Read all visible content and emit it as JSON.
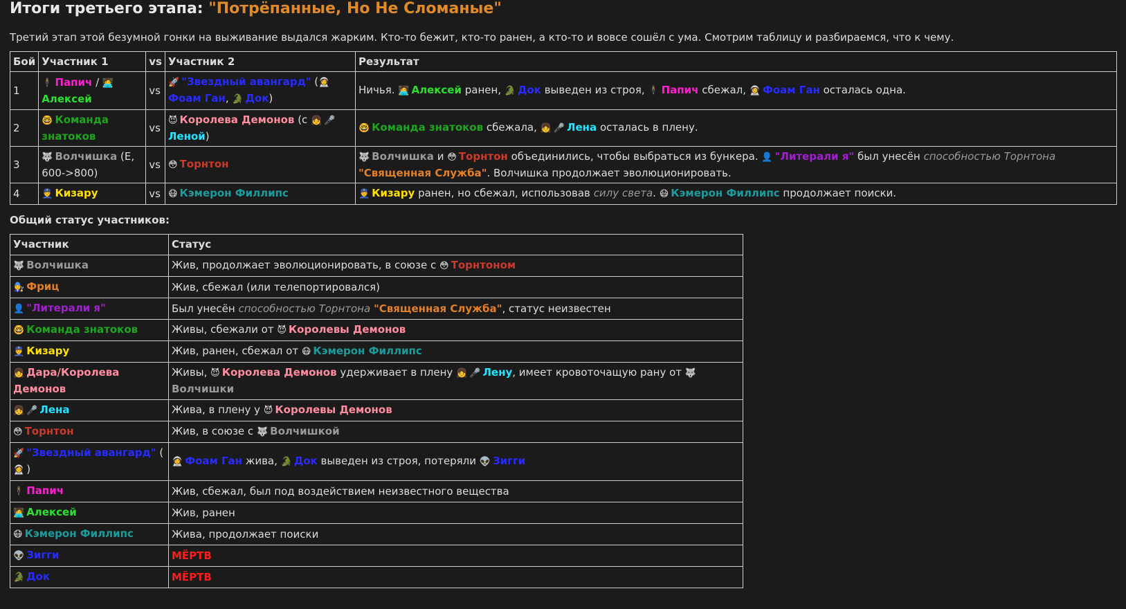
{
  "title": {
    "prefix": "Итоги третьего этапа: ",
    "highlight": "\"Потрёпанные, Но Не Сломаные\""
  },
  "intro": "Третий этап этой безумной гонки на выживание выдался жарким. Кто-то бежит, кто-то ранен, а кто-то и вовсе сошёл с ума. Смотрим таблицу и разбираемся, что к чему.",
  "table1": {
    "headers": [
      "Бой",
      "Участник 1",
      "vs",
      "Участник 2",
      "Результат"
    ],
    "rows": [
      {
        "num": "1",
        "vs": "vs",
        "p1": [
          [
            "emo",
            "🕴"
          ],
          [
            "c-magenta b",
            "Папич"
          ],
          [
            "",
            "/"
          ],
          [
            "emo",
            "🧑‍💻"
          ],
          [
            "c-green b",
            "Алексей"
          ]
        ],
        "p2": [
          [
            "emo",
            "🚀"
          ],
          [
            "c-blue b",
            "\"Звездный авангард\""
          ],
          [
            "",
            "("
          ],
          [
            "emo",
            "👩‍🚀"
          ],
          [
            "c-blue b",
            "Фоам Ган"
          ],
          [
            "",
            ","
          ],
          [
            "emo",
            "🐊"
          ],
          [
            "c-blue b",
            "Док"
          ],
          [
            "",
            ")"
          ]
        ],
        "res": [
          [
            "",
            "Ничья."
          ],
          [
            "emo",
            "🧑‍💻"
          ],
          [
            "c-green b",
            "Алексей"
          ],
          [
            "",
            "ранен,"
          ],
          [
            "emo",
            "🐊"
          ],
          [
            "c-blue b",
            "Док"
          ],
          [
            "",
            "выведен из строя,"
          ],
          [
            "emo",
            "🕴"
          ],
          [
            "c-magenta b",
            "Папич"
          ],
          [
            "",
            "сбежал,"
          ],
          [
            "emo",
            "👩‍🚀"
          ],
          [
            "c-blue b",
            "Фоам Ган"
          ],
          [
            "",
            "осталась одна."
          ]
        ]
      },
      {
        "num": "2",
        "vs": "vs",
        "p1": [
          [
            "emo",
            "🤓"
          ],
          [
            "c-dgreen b",
            "Команда знатоков"
          ]
        ],
        "p2": [
          [
            "emo",
            "😈"
          ],
          [
            "c-pink b",
            "Королева Демонов"
          ],
          [
            "",
            "(с"
          ],
          [
            "emo",
            "👧"
          ],
          [
            "emo",
            "🎤"
          ],
          [
            "c-cyan b",
            "Леной"
          ],
          [
            "",
            ")"
          ]
        ],
        "res": [
          [
            "emo",
            "🤓"
          ],
          [
            "c-dgreen b",
            "Команда знатоков"
          ],
          [
            "",
            "сбежала,"
          ],
          [
            "emo",
            "👧"
          ],
          [
            "emo",
            "🎤"
          ],
          [
            "c-cyan b",
            "Лена"
          ],
          [
            "",
            "осталась в плену."
          ]
        ]
      },
      {
        "num": "3",
        "vs": "vs",
        "p1": [
          [
            "emo",
            "🐺"
          ],
          [
            "c-gray b",
            "Волчишка"
          ],
          [
            "",
            "(Е, 600->800)"
          ]
        ],
        "p2": [
          [
            "emo",
            "😳"
          ],
          [
            "c-torn b",
            "Торнтон"
          ]
        ],
        "res": [
          [
            "emo",
            "🐺"
          ],
          [
            "c-gray b",
            "Волчишка"
          ],
          [
            "",
            "и"
          ],
          [
            "emo",
            "😳"
          ],
          [
            "c-torn b",
            "Торнтон"
          ],
          [
            "",
            "объединились, чтобы выбраться из бункера."
          ],
          [
            "emo",
            "👤"
          ],
          [
            "c-purple b",
            "\"Литерали я\""
          ],
          [
            "",
            "был унесён"
          ],
          [
            "c-gray i",
            "способностью Торнтона"
          ],
          [
            "c-orange b",
            "\"Священная Служба\""
          ],
          [
            "",
            ". Волчишка продолжает эволюционировать."
          ]
        ]
      },
      {
        "num": "4",
        "vs": "vs",
        "p1": [
          [
            "emo",
            "👮"
          ],
          [
            "c-yellow b",
            "Кизару"
          ]
        ],
        "p2": [
          [
            "emo",
            "😷"
          ],
          [
            "c-teal b",
            "Кэмерон Филлипс"
          ]
        ],
        "res": [
          [
            "emo",
            "👮"
          ],
          [
            "c-yellow b",
            "Кизару"
          ],
          [
            "",
            "ранен, но сбежал, использовав"
          ],
          [
            "c-gray i",
            "силу света"
          ],
          [
            "",
            ". "
          ],
          [
            "emo",
            "😷"
          ],
          [
            "c-teal b",
            "Кэмерон Филлипс"
          ],
          [
            "",
            "продолжает поиски."
          ]
        ]
      }
    ]
  },
  "status_heading": "Общий статус участников:",
  "table2": {
    "headers": [
      "Участник",
      "Статус"
    ],
    "rows": [
      {
        "name": [
          [
            "emo",
            "🐺"
          ],
          [
            "c-gray b",
            "Волчишка"
          ]
        ],
        "status": [
          [
            "",
            "Жив, продолжает эволюционировать, в союзе с"
          ],
          [
            "emo",
            "😳"
          ],
          [
            "c-torn b",
            "Торнтоном"
          ]
        ]
      },
      {
        "name": [
          [
            "emo",
            "🧑‍🔧"
          ],
          [
            "c-orange b",
            "Фриц"
          ]
        ],
        "status": [
          [
            "",
            "Жив, сбежал (или телепортировался)"
          ]
        ]
      },
      {
        "name": [
          [
            "emo",
            "👤"
          ],
          [
            "c-purple b",
            "\"Литерали я\""
          ]
        ],
        "status": [
          [
            "",
            "Был унесён"
          ],
          [
            "c-gray i",
            "способностью Торнтона"
          ],
          [
            "c-orange b",
            "\"Священная Служба\""
          ],
          [
            "",
            ", статус неизвестен"
          ]
        ]
      },
      {
        "name": [
          [
            "emo",
            "🤓"
          ],
          [
            "c-dgreen b",
            "Команда знатоков"
          ]
        ],
        "status": [
          [
            "",
            "Живы, сбежали от"
          ],
          [
            "emo",
            "😈"
          ],
          [
            "c-pink b",
            "Королевы Демонов"
          ]
        ]
      },
      {
        "name": [
          [
            "emo",
            "👮"
          ],
          [
            "c-yellow b",
            "Кизару"
          ]
        ],
        "status": [
          [
            "",
            "Жив, ранен, сбежал от"
          ],
          [
            "emo",
            "😷"
          ],
          [
            "c-teal b",
            "Кэмерон Филлипс"
          ]
        ]
      },
      {
        "name": [
          [
            "emo",
            "👧"
          ],
          [
            "c-pink b",
            "Дара/Королева Демонов"
          ]
        ],
        "status": [
          [
            "",
            "Живы,"
          ],
          [
            "emo",
            "😈"
          ],
          [
            "c-pink b",
            "Королева Демонов"
          ],
          [
            "",
            "удерживает в плену"
          ],
          [
            "emo",
            "👧"
          ],
          [
            "emo",
            "🎤"
          ],
          [
            "c-cyan b",
            "Лену"
          ],
          [
            "",
            ", имеет кровоточащую рану от"
          ],
          [
            "emo",
            "🐺"
          ],
          [
            "c-gray b",
            "Волчишки"
          ]
        ]
      },
      {
        "name": [
          [
            "emo",
            "👧"
          ],
          [
            "emo",
            "🎤"
          ],
          [
            "c-cyan b",
            "Лена"
          ]
        ],
        "status": [
          [
            "",
            "Жива, в плену у"
          ],
          [
            "emo",
            "😈"
          ],
          [
            "c-pink b",
            "Королевы Демонов"
          ]
        ]
      },
      {
        "name": [
          [
            "emo",
            "😳"
          ],
          [
            "c-torn b",
            "Торнтон"
          ]
        ],
        "status": [
          [
            "",
            "Жив, в союзе с"
          ],
          [
            "emo",
            "🐺"
          ],
          [
            "c-gray b",
            "Волчишкой"
          ]
        ]
      },
      {
        "name": [
          [
            "emo",
            "🚀"
          ],
          [
            "c-blue b",
            "\"Звездный авангард\""
          ],
          [
            "",
            "("
          ],
          [
            "emo",
            "👩‍🚀"
          ],
          [
            "",
            ")"
          ]
        ],
        "status": [
          [
            "emo",
            "👩‍🚀"
          ],
          [
            "c-blue b",
            "Фоам Ган"
          ],
          [
            "",
            "жива,"
          ],
          [
            "emo",
            "🐊"
          ],
          [
            "c-blue b",
            "Док"
          ],
          [
            "",
            "выведен из строя, потеряли"
          ],
          [
            "emo",
            "👽"
          ],
          [
            "c-blue b",
            "Зигги"
          ]
        ]
      },
      {
        "name": [
          [
            "emo",
            "🕴"
          ],
          [
            "c-magenta b",
            "Папич"
          ]
        ],
        "status": [
          [
            "",
            "Жив, сбежал, был под воздействием неизвестного вещества"
          ]
        ]
      },
      {
        "name": [
          [
            "emo",
            "🧑‍💻"
          ],
          [
            "c-green b",
            "Алексей"
          ]
        ],
        "status": [
          [
            "",
            "Жив, ранен"
          ]
        ]
      },
      {
        "name": [
          [
            "emo",
            "😷"
          ],
          [
            "c-teal b",
            "Кэмерон Филлипс"
          ]
        ],
        "status": [
          [
            "",
            "Жива, продолжает поиски"
          ]
        ]
      },
      {
        "name": [
          [
            "emo",
            "👽"
          ],
          [
            "c-blue b",
            "Зигги"
          ]
        ],
        "status": [
          [
            "c-dead b",
            "МЁРТВ"
          ]
        ]
      },
      {
        "name": [
          [
            "emo",
            "🐊"
          ],
          [
            "c-blue b",
            "Док"
          ]
        ],
        "status": [
          [
            "c-dead b",
            "МЁРТВ"
          ]
        ]
      }
    ]
  }
}
